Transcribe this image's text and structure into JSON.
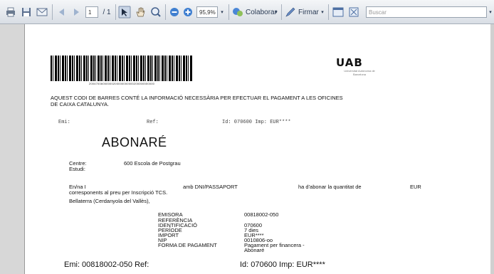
{
  "toolbar": {
    "page_current": "1",
    "page_total": "/ 1",
    "zoom": "95,9%",
    "collaborate": "Colaborar",
    "sign": "Firmar",
    "search_placeholder": "Buscar"
  },
  "doc": {
    "barcode_number": "20047006000000200000000000200000000000",
    "logo": "UAB",
    "logo_sub": "Universitat Autònoma de Barcelona",
    "notice": "AQUEST CODI DE BARRES CONTÉ LA INFORMACIÓ NECESSÀRIA PER EFECTUAR EL PAGAMENT A LES OFICINES",
    "notice2": "DE CAIXA CATALUNYA.",
    "emi_label": "Emi:",
    "ref_label": "Ref:",
    "id_line": "Id: 070600 Imp: EUR****",
    "title": "ABONARÉ",
    "centre_label": "Centre:",
    "centre_value": "600 Escola de Postgrau",
    "estudi_label": "Estudi:",
    "enna": "En/na I",
    "amb": "amb DNI/PASSAPORT",
    "abonar": "ha d'abonar la quantitat de",
    "eur": "EUR",
    "corresponents": "corresponents al preu per Inscripció TCS.",
    "lloc": "Bellaterra (Cerdanyola del Vallès),",
    "labels": [
      "EMISORA",
      "REFERÈNCIA",
      "IDENTIFICACIÓ",
      "PERÍODE",
      "IMPORT",
      "NIP",
      "FORMA DE PAGAMENT"
    ],
    "values": [
      "00818002-050",
      "",
      "070600",
      "7 dies",
      "EUR****",
      "0010806-oo",
      "Pagament per financera -",
      "Abonaré"
    ],
    "bottom_left": "Emi: 00818002-050 Ref:",
    "bottom_right": "Id: 070600 Imp: EUR****"
  }
}
